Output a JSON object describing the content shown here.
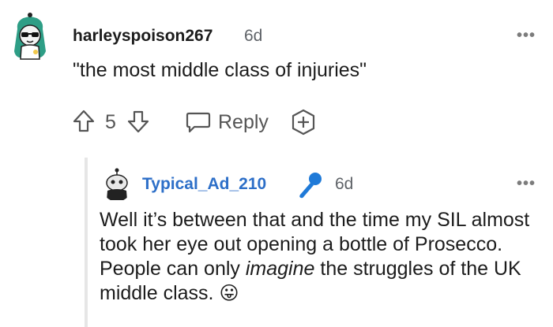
{
  "comment": {
    "username": "harleyspoison267",
    "age": "6d",
    "body": "\"the most middle class of injuries\"",
    "vote_count": "5",
    "reply_label": "Reply",
    "more_icon": "more-horizontal-icon"
  },
  "reply": {
    "username": "Typical_Ad_210",
    "age": "6d",
    "badge_icon": "microphone-icon",
    "body_before": "Well it’s between that and the time my SIL almost took her eye out opening a bottle of Prosecco. People can only ",
    "body_emph": "imagine",
    "body_after": " the struggles of the UK middle class.",
    "emoji": "😛",
    "more_icon": "more-horizontal-icon"
  },
  "colors": {
    "reply_username": "#2d6fc8",
    "badge": "#1f7ad8",
    "avatar_hair": "#2e9e86"
  }
}
